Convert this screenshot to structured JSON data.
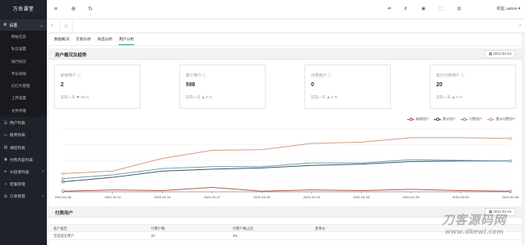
{
  "app": {
    "brand": "万岳课堂"
  },
  "sidebar": {
    "section": {
      "icon": "gear-icon",
      "label": "设置"
    },
    "sub_items": [
      "网站信息",
      "私信设置",
      "排行标识",
      "专长领域",
      "幻灯片管理",
      "上传设置",
      "文件存储"
    ],
    "items": [
      {
        "icon": "users-icon",
        "label": "用户列表",
        "caret": false
      },
      {
        "icon": "teacher-icon",
        "label": "教师列表",
        "caret": false
      },
      {
        "icon": "course-icon",
        "label": "课程列表",
        "caret": false
      },
      {
        "icon": "paid-content-icon",
        "label": "付费内容列表",
        "caret": false
      },
      {
        "icon": "live-icon",
        "label": "大班课列表",
        "caret": true
      },
      {
        "icon": "package-icon",
        "label": "套餐管理",
        "caret": false
      },
      {
        "icon": "order-icon",
        "label": "订单管理",
        "caret": true
      }
    ]
  },
  "topbar": {
    "user": "欢迎, admin ▾"
  },
  "tabs": {
    "items": [
      "数据概况",
      "交易分析",
      "商品分析",
      "用户分析"
    ],
    "active_index": 3
  },
  "overview": {
    "title": "用户概况及趋势",
    "date": "2021-02-04",
    "cards": [
      {
        "label": "新增用户 ⓘ",
        "value": "2",
        "compare": "较前一天",
        "trend": "down",
        "pct": "25 %"
      },
      {
        "label": "累计用户 ⓘ",
        "value": "598",
        "compare": "较前一天",
        "trend": "up",
        "pct": "0 %"
      },
      {
        "label": "付费用户 ⓘ",
        "value": "0",
        "compare": "较前一天",
        "trend": "up",
        "pct": "0 %"
      },
      {
        "label": "累计付费用户 ⓘ",
        "value": "20",
        "compare": "较前一天",
        "trend": "up",
        "pct": "0 %"
      }
    ]
  },
  "chart_data": {
    "type": "line",
    "x": [
      "2021-01-08",
      "2021-01-11",
      "2021-01-14",
      "2021-01-17",
      "2021-01-20",
      "2021-01-23",
      "2021-01-26",
      "2021-01-29",
      "2021-02-01",
      "2021-02-04"
    ],
    "series": [
      {
        "name": "新增用户",
        "color": "#b35b52",
        "values": [
          0.01,
          0.03,
          0.02,
          0.07,
          0.01,
          0.03,
          0.02,
          0.04,
          0.02,
          0.01
        ]
      },
      {
        "name": "累计用户",
        "color": "#3e5565",
        "values": [
          0.16,
          0.23,
          0.33,
          0.36,
          0.38,
          0.42,
          0.44,
          0.48,
          0.49,
          0.49
        ]
      },
      {
        "name": "付费用户",
        "color": "#6aa1ad",
        "values": [
          0.21,
          0.27,
          0.37,
          0.4,
          0.4,
          0.46,
          0.46,
          0.51,
          0.5,
          0.49
        ]
      },
      {
        "name": "累计付费用户",
        "color": "#d49b84",
        "values": [
          0.29,
          0.33,
          0.53,
          0.66,
          0.67,
          0.77,
          0.79,
          0.86,
          0.86,
          0.85
        ]
      }
    ],
    "ylim": [
      0,
      1
    ],
    "grid": true,
    "legend": "top-right"
  },
  "paid_users": {
    "title": "付费用户",
    "date": "2021-02-04",
    "columns": [
      "客户类型",
      "付费户数",
      "付费户数占比",
      "客单价"
    ],
    "rows": [
      [
        "全部成交用户",
        "20",
        "3%",
        ""
      ]
    ]
  },
  "watermark": {
    "line1": "刀客源码网",
    "line2": "www.dkewl.com"
  }
}
